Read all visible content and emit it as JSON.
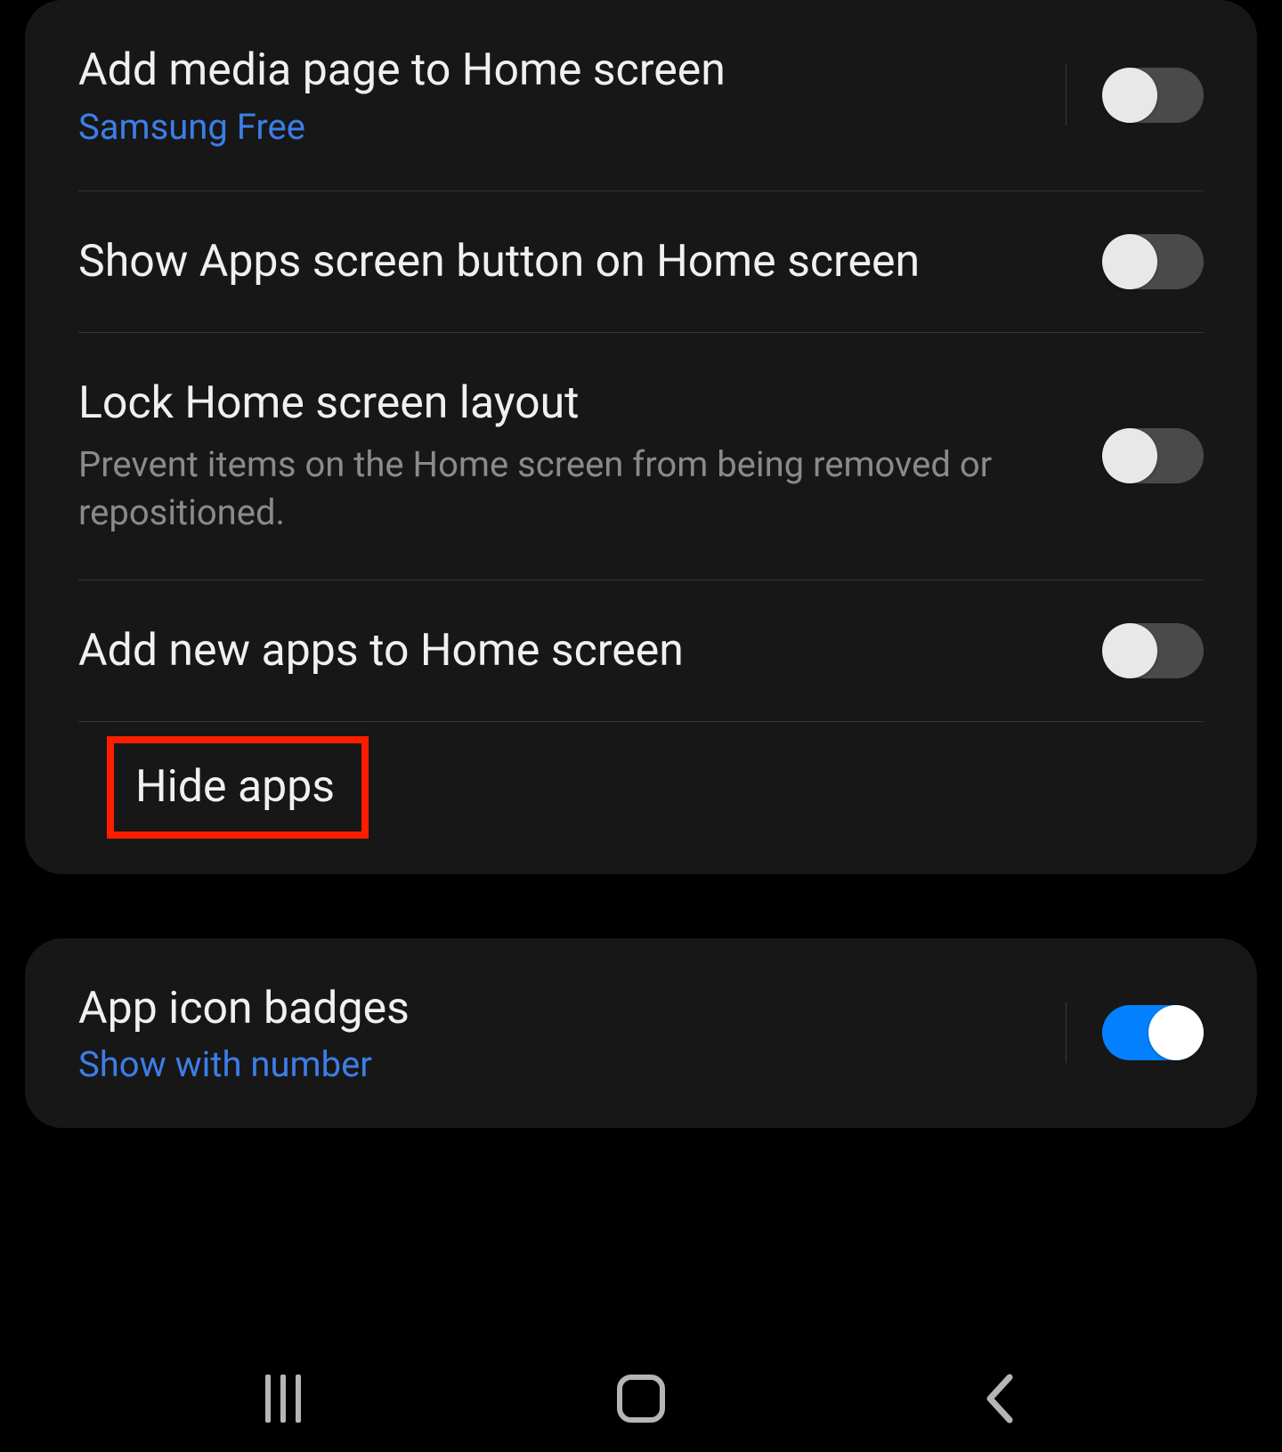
{
  "settings": {
    "items": [
      {
        "title": "Add media page to Home screen",
        "subtitle": "Samsung Free",
        "subtitle_type": "link",
        "toggle": "off",
        "has_vr": true
      },
      {
        "title": "Show Apps screen button on Home screen",
        "toggle": "off",
        "has_vr": false
      },
      {
        "title": "Lock Home screen layout",
        "subtitle": "Prevent items on the Home screen from being removed or repositioned.",
        "subtitle_type": "desc",
        "toggle": "off",
        "has_vr": false
      },
      {
        "title": "Add new apps to Home screen",
        "toggle": "off",
        "has_vr": false
      }
    ],
    "hide_apps_label": "Hide apps"
  },
  "badges": {
    "title": "App icon badges",
    "subtitle": "Show with number",
    "toggle": "on"
  }
}
